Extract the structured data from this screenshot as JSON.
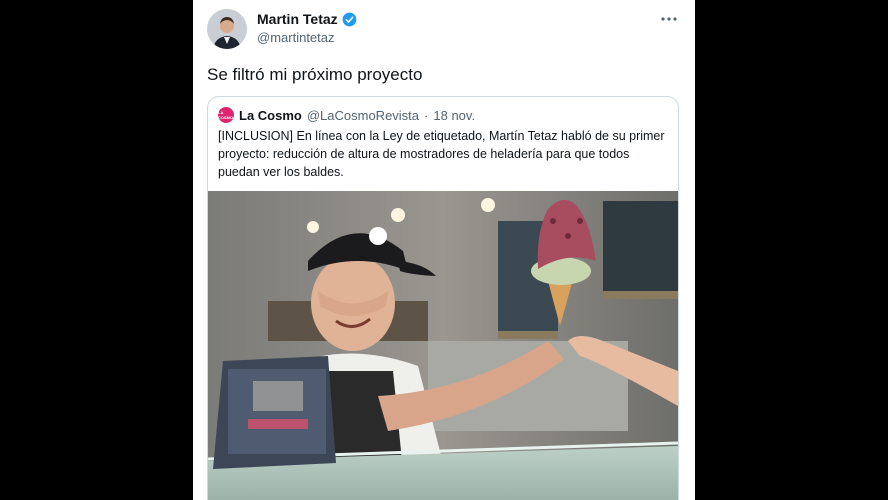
{
  "author": {
    "name": "Martin Tetaz",
    "handle": "@martintetaz"
  },
  "tweet": {
    "text": "Se filtró mi próximo proyecto"
  },
  "quoted": {
    "name": "La Cosmo",
    "handle": "@LaCosmoRevista",
    "separator": "·",
    "date": "18 nov.",
    "text": "[INCLUSION] En línea con la Ley de etiquetado, Martín Tetaz habló de su primer proyecto: reducción de altura de mostradores de heladería para que todos puedan ver los baldes.",
    "logo_text": "LA COSMO"
  },
  "icons": {
    "verified": "verified-badge-icon",
    "more": "more-options-icon"
  },
  "colors": {
    "verified": "#1d9bf0",
    "brand": "#e0246f",
    "secondary_text": "#536471",
    "border": "#cfd9de"
  }
}
